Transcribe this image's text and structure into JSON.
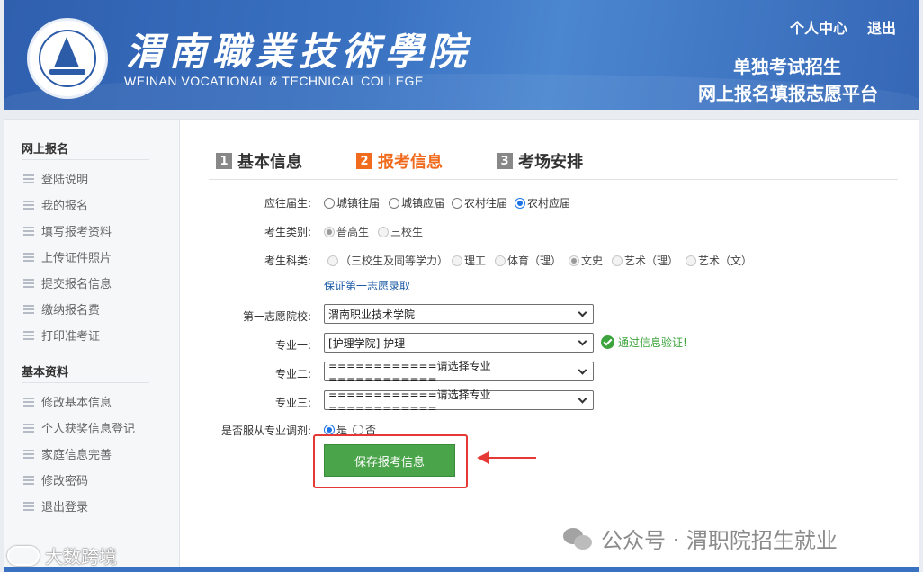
{
  "header": {
    "college_cn": "渭南職業技術學院",
    "college_en": "WEINAN VOCATIONAL & TECHNICAL COLLEGE",
    "nav": [
      "个人中心",
      "退出"
    ],
    "slogan_line1": "单独考试招生",
    "slogan_line2": "网上报名填报志愿平台"
  },
  "sidebar": {
    "group1": "网上报名",
    "items1": [
      "登陆说明",
      "我的报名",
      "填写报考资料",
      "上传证件照片",
      "提交报名信息",
      "缴纳报名费",
      "打印准考证"
    ],
    "group2": "基本资料",
    "items2": [
      "修改基本信息",
      "个人获奖信息登记",
      "家庭信息完善",
      "修改密码",
      "退出登录"
    ]
  },
  "steps": [
    {
      "num": "1",
      "label": "基本信息",
      "active": false
    },
    {
      "num": "2",
      "label": "报考信息",
      "active": true
    },
    {
      "num": "3",
      "label": "考场安排",
      "active": false
    }
  ],
  "form": {
    "residence_label": "应往届生:",
    "residence_options": [
      "城镇往届",
      "城镇应届",
      "农村往届",
      "农村应届"
    ],
    "residence_selected": "农村应届",
    "type_label": "考生类别:",
    "type_options": [
      "普高生",
      "三校生"
    ],
    "type_selected": "普高生",
    "subject_label": "考生科类:",
    "subject_options": [
      "（三校生及同等学力）",
      "理工",
      "体育（理）",
      "文史",
      "艺术（理）",
      "艺术（文）"
    ],
    "subject_selected": "文史",
    "guarantee_link": "保证第一志愿录取",
    "school_label": "第一志愿院校:",
    "school_value": "渭南职业技术学院",
    "major1_label": "专业一:",
    "major1_value": "[护理学院] 护理",
    "verify_text": "通过信息验证!",
    "major2_label": "专业二:",
    "major2_value": "============请选择专业============",
    "major3_label": "专业三:",
    "major3_value": "============请选择专业============",
    "adjust_label": "是否服从专业调剂:",
    "adjust_options": [
      "是",
      "否"
    ],
    "adjust_selected": "是",
    "save_label": "保存报考信息"
  },
  "watermarks": {
    "right": "公众号 · 渭职院招生就业",
    "left": "大数跨境"
  },
  "colors": {
    "header_blue": "#3a72c2",
    "active_step": "#f06b1e",
    "save_green": "#4aa449",
    "highlight_red": "#e53935",
    "verify_green": "#3da43d"
  }
}
